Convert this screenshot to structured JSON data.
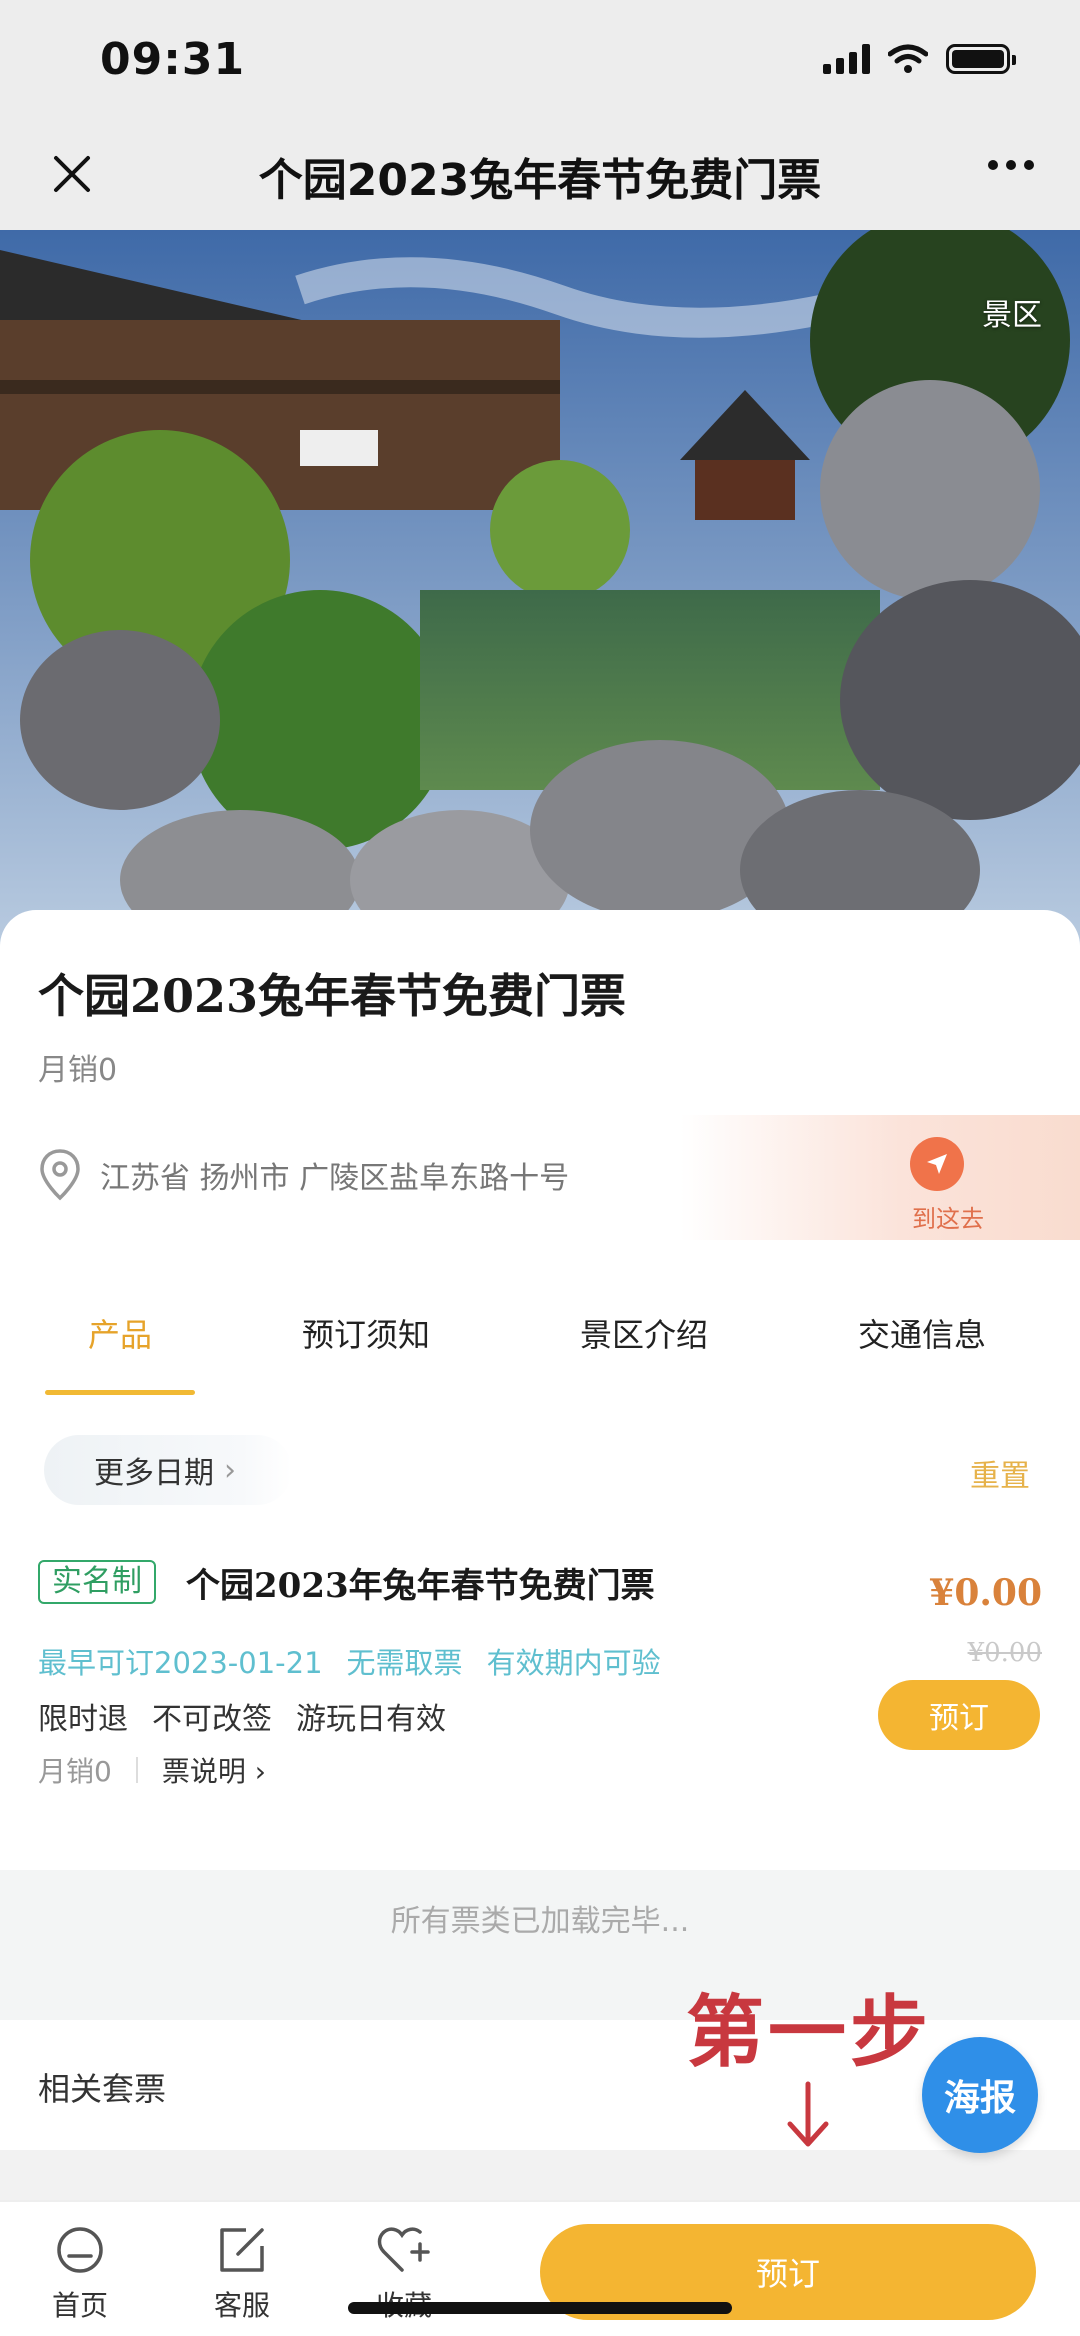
{
  "status_bar": {
    "time": "09:31"
  },
  "nav": {
    "title": "个园2023兔年春节免费门票"
  },
  "hero": {
    "tag": "景区"
  },
  "product": {
    "title": "个园2023兔年春节免费门票",
    "monthly_sales": "月销0",
    "address": "江苏省 扬州市 广陵区盐阜东路十号",
    "goto_label": "到这去"
  },
  "tabs": [
    {
      "label": "产品",
      "active": true
    },
    {
      "label": "预订须知"
    },
    {
      "label": "景区介绍"
    },
    {
      "label": "交通信息"
    }
  ],
  "date_filter": {
    "more_dates": "更多日期",
    "reset": "重置"
  },
  "ticket": {
    "badge": "实名制",
    "title": "个园2023年兔年春节免费门票",
    "price": "¥0.00",
    "original_price": "¥0.00",
    "tags_info": [
      "最早可订2023-01-21",
      "无需取票",
      "有效期内可验"
    ],
    "tags_rules": [
      "限时退",
      "不可改签",
      "游玩日有效"
    ],
    "sales": "月销0",
    "ticket_note": "票说明",
    "book_label": "预订"
  },
  "loaded_text": "所有票类已加载完毕...",
  "related_label": "相关套票",
  "annotation": "第一步",
  "poster_label": "海报",
  "bottom_bar": {
    "home": "首页",
    "service": "客服",
    "favorite": "收藏",
    "book": "预订"
  },
  "colors": {
    "accent": "#f4b532",
    "tab_active": "#e6a32a",
    "price": "#d9823b",
    "badge_green": "#2f9e62",
    "info_blue": "#5fbfcf",
    "annotation_red": "#c8383f",
    "poster_blue": "#2f8fe8"
  }
}
